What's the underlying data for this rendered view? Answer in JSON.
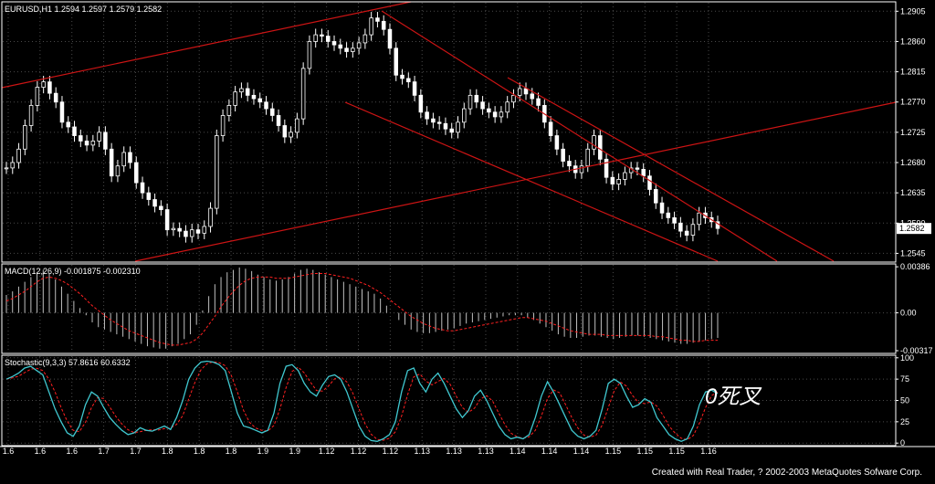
{
  "colors": {
    "background": "#000000",
    "panel_border": "#ffffff",
    "grid": "#4a4a4a",
    "candle": "#ffffff",
    "trendline": "#cc1414",
    "macd_histogram": "#c0c0c0",
    "macd_signal": "#ff2020",
    "stoch_main": "#40c8d0",
    "stoch_signal": "#ff2020",
    "annotation": "#ffffff"
  },
  "footer": {
    "credit": "Created with Real Trader, ? 2002-2003 MetaQuotes Sofware Corp."
  },
  "chart_data": [
    {
      "type": "candlestick",
      "title": "EURUSD,H1  1.2594 1.2597 1.2579 1.2582",
      "x_tick_labels": [
        "1.6",
        "1.6",
        "1.6",
        "1.7",
        "1.7",
        "1.8",
        "1.8",
        "1.8",
        "1.9",
        "1.9",
        "1.12",
        "1.12",
        "1.12",
        "1.13",
        "1.13",
        "1.13",
        "1.14",
        "1.14",
        "1.14",
        "1.15",
        "1.15",
        "1.15",
        "1.16"
      ],
      "y_tick_labels": [
        "1.2905",
        "1.2860",
        "1.2815",
        "1.2770",
        "1.2725",
        "1.2680",
        "1.2635",
        "1.2590",
        "1.2545"
      ],
      "ylim": [
        1.2532,
        1.2919
      ],
      "current_price_label": "1.2582",
      "grid": true,
      "close": [
        1.2672,
        1.268,
        1.27,
        1.2735,
        1.2765,
        1.2792,
        1.28,
        1.2783,
        1.277,
        1.274,
        1.2733,
        1.272,
        1.2712,
        1.2706,
        1.2712,
        1.2725,
        1.27,
        1.266,
        1.2675,
        1.2695,
        1.268,
        1.265,
        1.2635,
        1.2625,
        1.2615,
        1.261,
        1.258,
        1.2582,
        1.2578,
        1.257,
        1.258,
        1.2575,
        1.2585,
        1.2612,
        1.272,
        1.275,
        1.2765,
        1.2785,
        1.279,
        1.278,
        1.2775,
        1.277,
        1.276,
        1.275,
        1.2735,
        1.2718,
        1.2725,
        1.2745,
        1.282,
        1.286,
        1.287,
        1.2868,
        1.286,
        1.2855,
        1.285,
        1.2845,
        1.285,
        1.2858,
        1.287,
        1.2895,
        1.289,
        1.2878,
        1.285,
        1.281,
        1.2805,
        1.28,
        1.278,
        1.2755,
        1.2745,
        1.274,
        1.2738,
        1.273,
        1.2725,
        1.274,
        1.276,
        1.278,
        1.277,
        1.276,
        1.2755,
        1.2748,
        1.2755,
        1.277,
        1.278,
        1.279,
        1.2782,
        1.2775,
        1.2765,
        1.274,
        1.272,
        1.27,
        1.2682,
        1.2675,
        1.2665,
        1.2675,
        1.27,
        1.272,
        1.2685,
        1.2658,
        1.2648,
        1.2655,
        1.2665,
        1.2672,
        1.267,
        1.266,
        1.264,
        1.262,
        1.2605,
        1.2598,
        1.259,
        1.2578,
        1.2572,
        1.2588,
        1.2605,
        1.2598,
        1.2592,
        1.2582
      ]
    },
    {
      "type": "line",
      "title": "MACD(12,26,9)  -0.001875  -0.002310",
      "y_tick_labels": [
        "0.00386",
        "0.00",
        "-0.00317"
      ],
      "ylim": [
        -0.0034,
        0.0041
      ],
      "histogram": [
        0.0015,
        0.0018,
        0.0022,
        0.0026,
        0.003,
        0.0034,
        0.0036,
        0.0033,
        0.0028,
        0.0022,
        0.0016,
        0.001,
        0.0004,
        -0.0002,
        -0.0008,
        -0.0012,
        -0.0014,
        -0.0016,
        -0.0018,
        -0.002,
        -0.0022,
        -0.0024,
        -0.0026,
        -0.0028,
        -0.0029,
        -0.003,
        -0.003,
        -0.0028,
        -0.0026,
        -0.0022,
        -0.0018,
        -0.001,
        0.0002,
        0.0014,
        0.0024,
        0.003,
        0.0034,
        0.0036,
        0.0038,
        0.0037,
        0.0035,
        0.0032,
        0.003,
        0.0028,
        0.0027,
        0.0028,
        0.003,
        0.0033,
        0.0036,
        0.0037,
        0.0036,
        0.0034,
        0.0032,
        0.003,
        0.0028,
        0.0026,
        0.0024,
        0.0022,
        0.002,
        0.0018,
        0.0016,
        0.0012,
        0.0006,
        0.0,
        -0.0006,
        -0.001,
        -0.0014,
        -0.0016,
        -0.0017,
        -0.0017,
        -0.0016,
        -0.0015,
        -0.0014,
        -0.0013,
        -0.0011,
        -0.0009,
        -0.0008,
        -0.0007,
        -0.0006,
        -0.0005,
        -0.0004,
        -0.0003,
        -0.0002,
        -0.0002,
        -0.0002,
        -0.0004,
        -0.0006,
        -0.0009,
        -0.0012,
        -0.0015,
        -0.0018,
        -0.002,
        -0.0021,
        -0.0021,
        -0.002,
        -0.0019,
        -0.0019,
        -0.002,
        -0.0021,
        -0.0022,
        -0.0021,
        -0.002,
        -0.0019,
        -0.0019,
        -0.002,
        -0.0021,
        -0.0022,
        -0.0023,
        -0.0024,
        -0.0025,
        -0.0026,
        -0.0026,
        -0.0025,
        -0.0024,
        -0.0023,
        -0.0022,
        -0.0021
      ],
      "signal": [
        0.001,
        0.0012,
        0.0015,
        0.0018,
        0.0022,
        0.0026,
        0.0029,
        0.003,
        0.0029,
        0.0027,
        0.0024,
        0.002,
        0.0016,
        0.0011,
        0.0006,
        0.0002,
        -0.0002,
        -0.0006,
        -0.0009,
        -0.0012,
        -0.0015,
        -0.0017,
        -0.0019,
        -0.0021,
        -0.0023,
        -0.0025,
        -0.0026,
        -0.0027,
        -0.0027,
        -0.0026,
        -0.0025,
        -0.0022,
        -0.0017,
        -0.001,
        -0.0003,
        0.0005,
        0.0012,
        0.0018,
        0.0023,
        0.0027,
        0.0029,
        0.003,
        0.003,
        0.003,
        0.0029,
        0.0029,
        0.0029,
        0.003,
        0.0031,
        0.0032,
        0.0033,
        0.0033,
        0.0033,
        0.0032,
        0.0031,
        0.003,
        0.0029,
        0.0027,
        0.0025,
        0.0023,
        0.002,
        0.0017,
        0.0013,
        0.0009,
        0.0005,
        0.0001,
        -0.0003,
        -0.0006,
        -0.0009,
        -0.0011,
        -0.0013,
        -0.0014,
        -0.0015,
        -0.0015,
        -0.0014,
        -0.0013,
        -0.0012,
        -0.0011,
        -0.001,
        -0.0009,
        -0.0008,
        -0.0007,
        -0.0006,
        -0.0005,
        -0.0004,
        -0.0004,
        -0.0005,
        -0.0006,
        -0.0007,
        -0.0009,
        -0.0011,
        -0.0013,
        -0.0015,
        -0.0016,
        -0.0017,
        -0.0018,
        -0.0018,
        -0.0018,
        -0.0019,
        -0.0019,
        -0.0019,
        -0.0019,
        -0.0019,
        -0.0019,
        -0.0019,
        -0.0019,
        -0.002,
        -0.002,
        -0.0021,
        -0.0022,
        -0.0023,
        -0.0023,
        -0.0024,
        -0.0024,
        -0.0023,
        -0.0023,
        -0.0023
      ]
    },
    {
      "type": "line",
      "title": "Stochastic(9,3,3)  57.8616  60.6332",
      "y_tick_labels": [
        "100",
        "75",
        "50",
        "25",
        "0"
      ],
      "ylim": [
        -3,
        103
      ],
      "annotation": "0死叉",
      "main": [
        75,
        78,
        82,
        88,
        90,
        85,
        80,
        60,
        40,
        25,
        12,
        8,
        20,
        45,
        60,
        55,
        42,
        30,
        22,
        15,
        10,
        12,
        18,
        15,
        14,
        17,
        20,
        16,
        30,
        50,
        75,
        88,
        95,
        96,
        95,
        92,
        85,
        60,
        35,
        20,
        18,
        15,
        12,
        15,
        35,
        70,
        90,
        92,
        85,
        70,
        60,
        55,
        68,
        78,
        80,
        75,
        60,
        40,
        20,
        8,
        3,
        2,
        5,
        10,
        25,
        60,
        85,
        88,
        70,
        60,
        75,
        82,
        70,
        55,
        40,
        30,
        38,
        55,
        62,
        50,
        35,
        20,
        10,
        5,
        7,
        5,
        10,
        30,
        55,
        72,
        60,
        45,
        30,
        15,
        8,
        5,
        8,
        15,
        40,
        70,
        75,
        70,
        55,
        42,
        45,
        52,
        48,
        30,
        20,
        10,
        5,
        2,
        5,
        20,
        45,
        60,
        62,
        58
      ]
    }
  ]
}
